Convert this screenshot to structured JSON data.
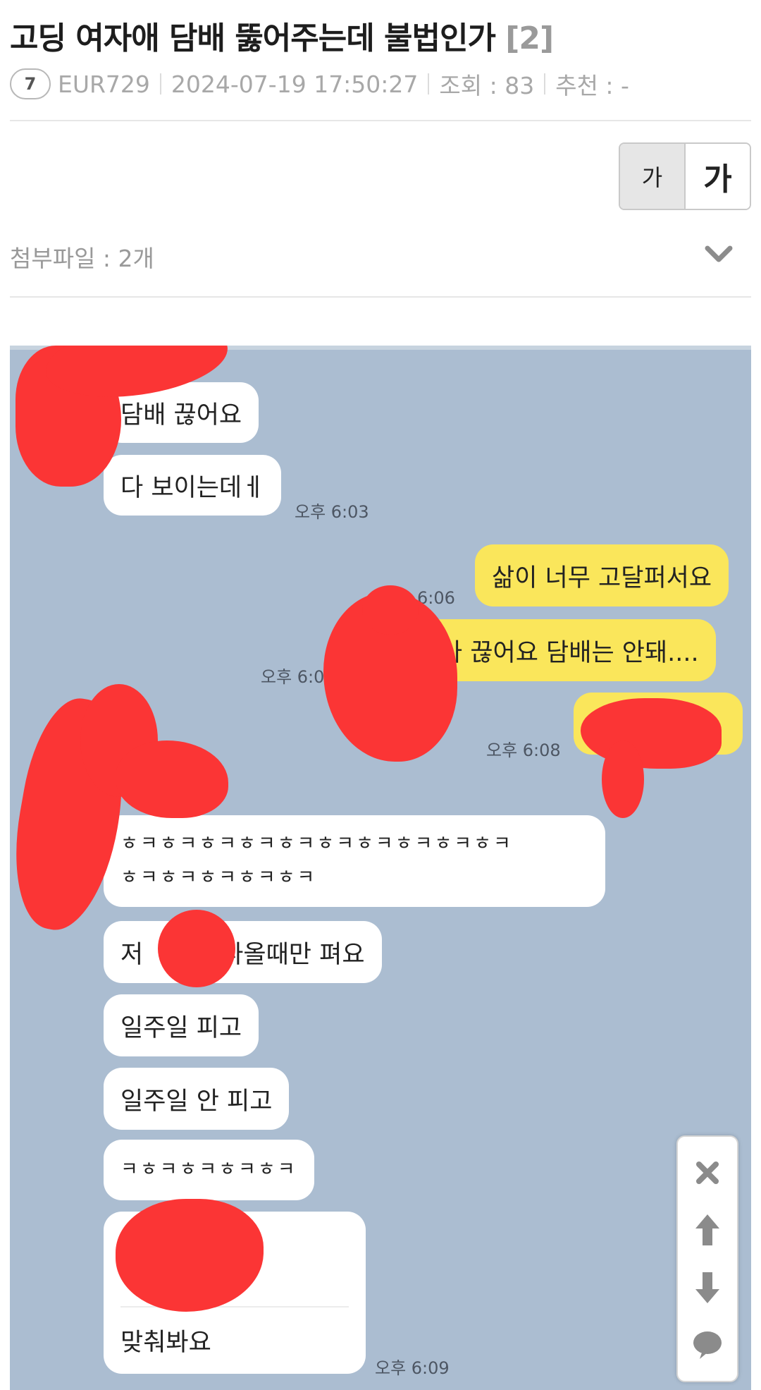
{
  "post": {
    "title": "고딩 여자애 담배 뚫어주는데 불법인가",
    "comment_count": "[2]",
    "author_level": "7",
    "author": "EUR729",
    "date": "2024-07-19 17:50:27",
    "views": "조회 : 83",
    "recommend": "추천 : -",
    "attachments": "첨부파일 : 2개"
  },
  "font_toggle": {
    "small": "가",
    "large": "가"
  },
  "chat": {
    "messages": [
      {
        "side": "left",
        "text": "담배 끊어요"
      },
      {
        "side": "left",
        "text": "다 보이는데ㅔ"
      },
      {
        "side": "right",
        "text": "삶이 너무 고달퍼서요"
      },
      {
        "side": "right",
        "text": "나 끊어요 담배는 안돼...."
      },
      {
        "side": "left",
        "text": "ㅎㅋㅎㅋㅎㅋㅎㅋㅎㅋㅎㅋㅎㅋㅎㅋㅎㅋㅎㅋ"
      },
      {
        "side": "left",
        "text": "ㅎㅋㅎㅋㅎㅋㅎㅋㅎㅋ"
      },
      {
        "side": "left",
        "text_a": "저",
        "text_b": "나올때만 펴요"
      },
      {
        "side": "left",
        "text": "일주일 피고"
      },
      {
        "side": "left",
        "text": "일주일 안 피고"
      },
      {
        "side": "left",
        "text": "ㅋㅎㅋㅎㅋㅎㅋㅎㅋ"
      },
      {
        "side": "left",
        "text": "맞춰봐요"
      }
    ],
    "times": {
      "t603": "오후 6:03",
      "t606": "6:06",
      "t60x": "오후 6:0",
      "t608": "오후 6:08",
      "t609": "오후 6:09"
    }
  },
  "icons": {
    "level_badge": "level-badge-icon",
    "dropdown": "chevron-down-icon",
    "close": "close-icon",
    "up": "arrow-up-icon",
    "down": "arrow-down-icon",
    "comment": "comment-bubble-icon"
  }
}
